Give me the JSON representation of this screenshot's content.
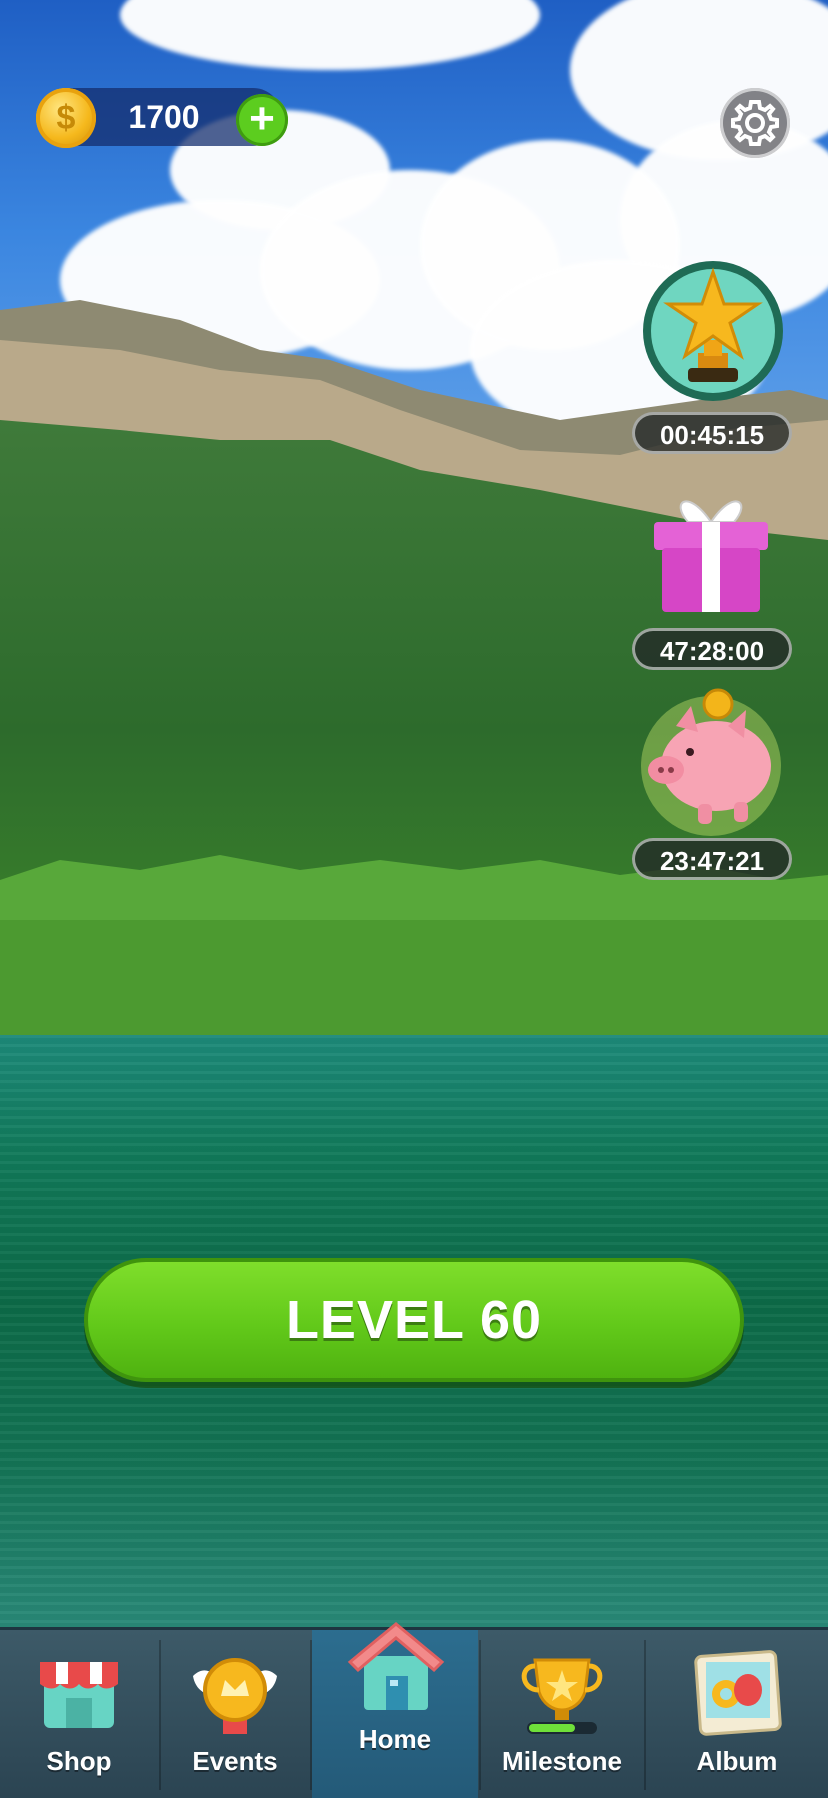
{
  "currency": {
    "amount": "1700",
    "coin_symbol": "$",
    "plus_symbol": "+"
  },
  "side_events": [
    {
      "name": "star-trophy",
      "timer": "00:45:15"
    },
    {
      "name": "gift-box",
      "timer": "47:28:00"
    },
    {
      "name": "piggy-bank",
      "timer": "23:47:21"
    }
  ],
  "play_button": {
    "label": "LEVEL 60"
  },
  "nav": {
    "items": [
      {
        "label": "Shop",
        "icon": "shop-icon"
      },
      {
        "label": "Events",
        "icon": "events-icon"
      },
      {
        "label": "Home",
        "icon": "home-icon",
        "active": true
      },
      {
        "label": "Milestone",
        "icon": "milestone-icon"
      },
      {
        "label": "Album",
        "icon": "album-icon"
      }
    ]
  },
  "colors": {
    "accent_green": "#62c91a",
    "nav_bg": "#2b4452",
    "active_tab": "#245a78"
  }
}
